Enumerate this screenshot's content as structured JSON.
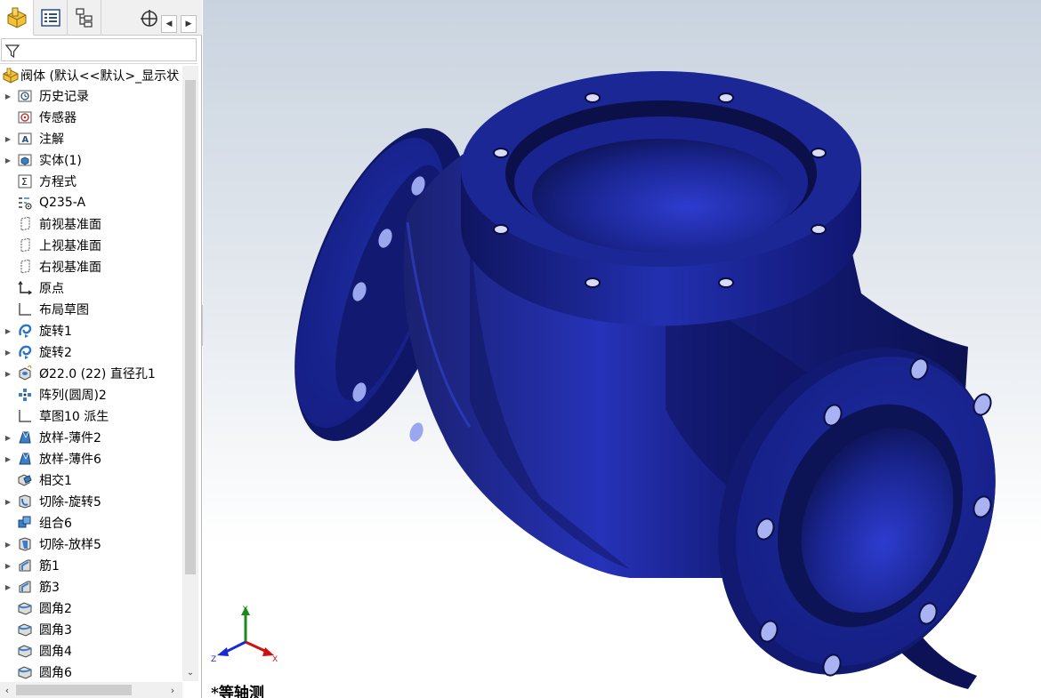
{
  "panel": {
    "tabs": [
      {
        "name": "feature-manager-tab",
        "icon": "part-icon",
        "active": true
      },
      {
        "name": "property-manager-tab",
        "icon": "property-list-icon",
        "active": false
      },
      {
        "name": "configuration-manager-tab",
        "icon": "configuration-tree-icon",
        "active": false
      },
      {
        "name": "dimxpert-manager-tab",
        "icon": "crosshair-icon",
        "active": false
      }
    ],
    "filter_icon": "filter-icon",
    "root_label": "阀体  (默认<<默认>_显示状",
    "tree_items": [
      {
        "label": "历史记录",
        "icon": "history-icon",
        "expandable": true
      },
      {
        "label": "传感器",
        "icon": "sensor-icon",
        "expandable": false
      },
      {
        "label": "注解",
        "icon": "annotation-icon",
        "expandable": true
      },
      {
        "label": "实体(1)",
        "icon": "solid-body-icon",
        "expandable": true
      },
      {
        "label": "方程式",
        "icon": "equation-icon",
        "expandable": false
      },
      {
        "label": "Q235-A",
        "icon": "material-icon",
        "expandable": false
      },
      {
        "label": "前视基准面",
        "icon": "plane-icon",
        "expandable": false
      },
      {
        "label": "上视基准面",
        "icon": "plane-icon",
        "expandable": false
      },
      {
        "label": "右视基准面",
        "icon": "plane-icon",
        "expandable": false
      },
      {
        "label": "原点",
        "icon": "origin-icon",
        "expandable": false
      },
      {
        "label": "布局草图",
        "icon": "sketch-icon",
        "expandable": false
      },
      {
        "label": "旋转1",
        "icon": "revolve-icon",
        "expandable": true
      },
      {
        "label": "旋转2",
        "icon": "revolve-icon",
        "expandable": true
      },
      {
        "label": "Ø22.0 (22) 直径孔1",
        "icon": "hole-wizard-icon",
        "expandable": true
      },
      {
        "label": "阵列(圆周)2",
        "icon": "circular-pattern-icon",
        "expandable": false
      },
      {
        "label": "草图10 派生",
        "icon": "sketch-icon",
        "expandable": false
      },
      {
        "label": "放样-薄件2",
        "icon": "loft-icon",
        "expandable": true
      },
      {
        "label": "放样-薄件6",
        "icon": "loft-icon",
        "expandable": true
      },
      {
        "label": "相交1",
        "icon": "intersect-icon",
        "expandable": false
      },
      {
        "label": "切除-旋转5",
        "icon": "cut-revolve-icon",
        "expandable": true
      },
      {
        "label": "组合6",
        "icon": "combine-icon",
        "expandable": false
      },
      {
        "label": "切除-放样5",
        "icon": "cut-loft-icon",
        "expandable": true
      },
      {
        "label": "筋1",
        "icon": "rib-icon",
        "expandable": true
      },
      {
        "label": "筋3",
        "icon": "rib-icon",
        "expandable": true
      },
      {
        "label": "圆角2",
        "icon": "fillet-icon",
        "expandable": false
      },
      {
        "label": "圆角3",
        "icon": "fillet-icon",
        "expandable": false
      },
      {
        "label": "圆角4",
        "icon": "fillet-icon",
        "expandable": false
      },
      {
        "label": "圆角6",
        "icon": "fillet-icon",
        "expandable": false
      }
    ]
  },
  "viewport": {
    "view_name": "*等轴测",
    "triad": {
      "x_label": "X",
      "y_label": "Y",
      "z_label": "Z"
    },
    "model_color": "#1c2a9a",
    "background_top": "#c9d3df",
    "background_bottom": "#ffffff"
  }
}
